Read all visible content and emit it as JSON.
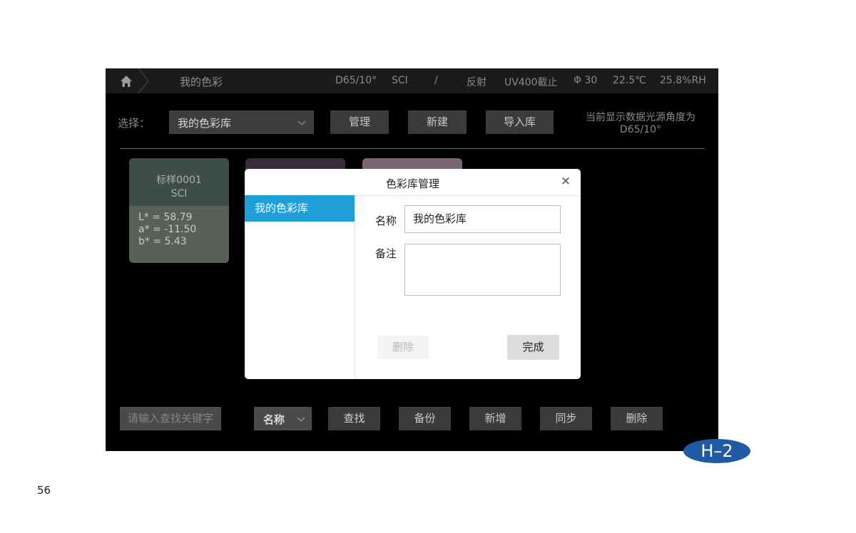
{
  "topbar": {
    "title": "我的色彩",
    "illuminant": "D65/10°",
    "mode": "SCI",
    "slash": "/",
    "measure": "反射",
    "uv": "UV400截止",
    "aperture": "Φ 30",
    "temperature": "22.5℃",
    "humidity": "25.8%RH"
  },
  "toolbar": {
    "select_label": "选择：",
    "library_value": "我的色彩库",
    "manage_label": "管理",
    "new_label": "新建",
    "import_label": "导入库",
    "note_line1": "当前显示数据光源角度为",
    "note_line2": "D65/10°"
  },
  "card": {
    "name": "标样0001",
    "mode": "SCI",
    "L": "L* = 58.79",
    "a": "a* = -11.50",
    "b": "b* = 5.43"
  },
  "bottom": {
    "search_placeholder": "请输入查找关键字",
    "field_value": "名称",
    "find_label": "查找",
    "backup_label": "备份",
    "add_label": "新增",
    "sync_label": "同步",
    "delete_label": "删除"
  },
  "dialog": {
    "title": "色彩库管理",
    "close": "×",
    "side_item": "我的色彩库",
    "name_label": "名称",
    "name_value": "我的色彩库",
    "remark_label": "备注",
    "delete_label": "删除",
    "done_label": "完成"
  },
  "badge": "H–2",
  "page_number": "56",
  "colors": {
    "accent": "#1e9fd9",
    "badge": "#1f5aa4",
    "sample_card": "#586058"
  }
}
